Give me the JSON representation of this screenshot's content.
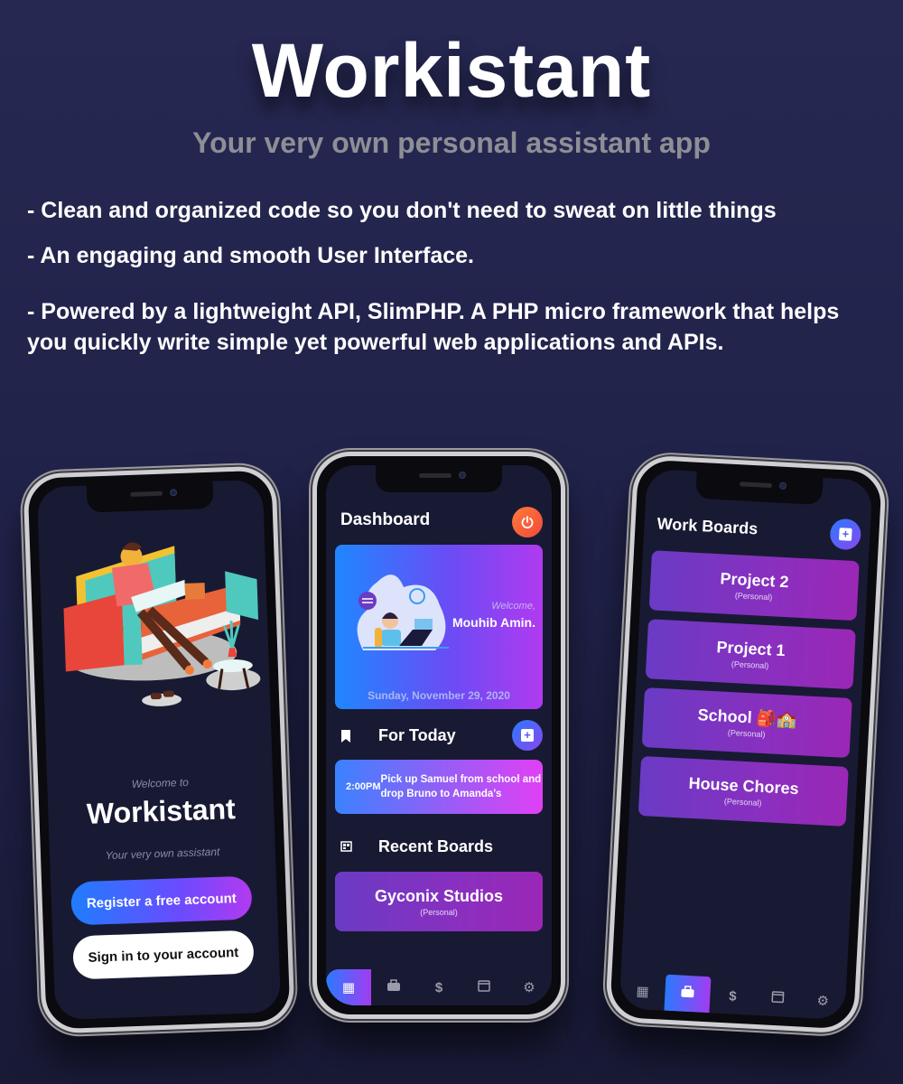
{
  "hero": {
    "title": "Workistant",
    "subtitle": "Your very own personal assistant app",
    "features": [
      "- Clean and organized code so you don't need to sweat on little things",
      "- An engaging and smooth User Interface.",
      "- Powered by a lightweight API, SlimPHP. A PHP micro framework that helps you quickly write simple yet powerful web applications and APIs."
    ]
  },
  "welcome_screen": {
    "welcome_to": "Welcome to",
    "app_name": "Workistant",
    "tagline": "Your very own assistant",
    "register_label": "Register a free account",
    "signin_label": "Sign in to your account"
  },
  "dashboard_screen": {
    "title": "Dashboard",
    "power_icon": "power-icon",
    "welcome_label": "Welcome,",
    "user_name": "Mouhib Amin.",
    "date": "Sunday, November 29, 2020",
    "for_today_label": "For Today",
    "task": {
      "time": "2:00PM",
      "text": "Pick up Samuel from school and drop Bruno to Amanda's"
    },
    "recent_boards_label": "Recent Boards",
    "recent_board": {
      "name": "Gyconix Studios",
      "type": "(Personal)"
    },
    "tabs": [
      {
        "icon": "dashboard-icon",
        "glyph": "▦",
        "active": true
      },
      {
        "icon": "briefcase-icon",
        "glyph": "💼",
        "active": false
      },
      {
        "icon": "dollar-icon",
        "glyph": "$",
        "active": false
      },
      {
        "icon": "calendar-icon",
        "glyph": "▣",
        "active": false
      },
      {
        "icon": "gear-icon",
        "glyph": "⚙",
        "active": false
      }
    ]
  },
  "boards_screen": {
    "title": "Work Boards",
    "boards": [
      {
        "name": "Project 2",
        "type": "(Personal)"
      },
      {
        "name": "Project 1",
        "type": "(Personal)"
      },
      {
        "name": "School 🎒🏫",
        "type": "(Personal)"
      },
      {
        "name": "House Chores",
        "type": "(Personal)"
      }
    ],
    "active_tab": "briefcase"
  },
  "colors": {
    "background": "#22244c",
    "screen_bg": "#181a33",
    "accent_blue": "#1f7dff",
    "accent_purple": "#b23af0",
    "power_red": "#f24a3a",
    "board_purple": "#8a2fbf"
  }
}
